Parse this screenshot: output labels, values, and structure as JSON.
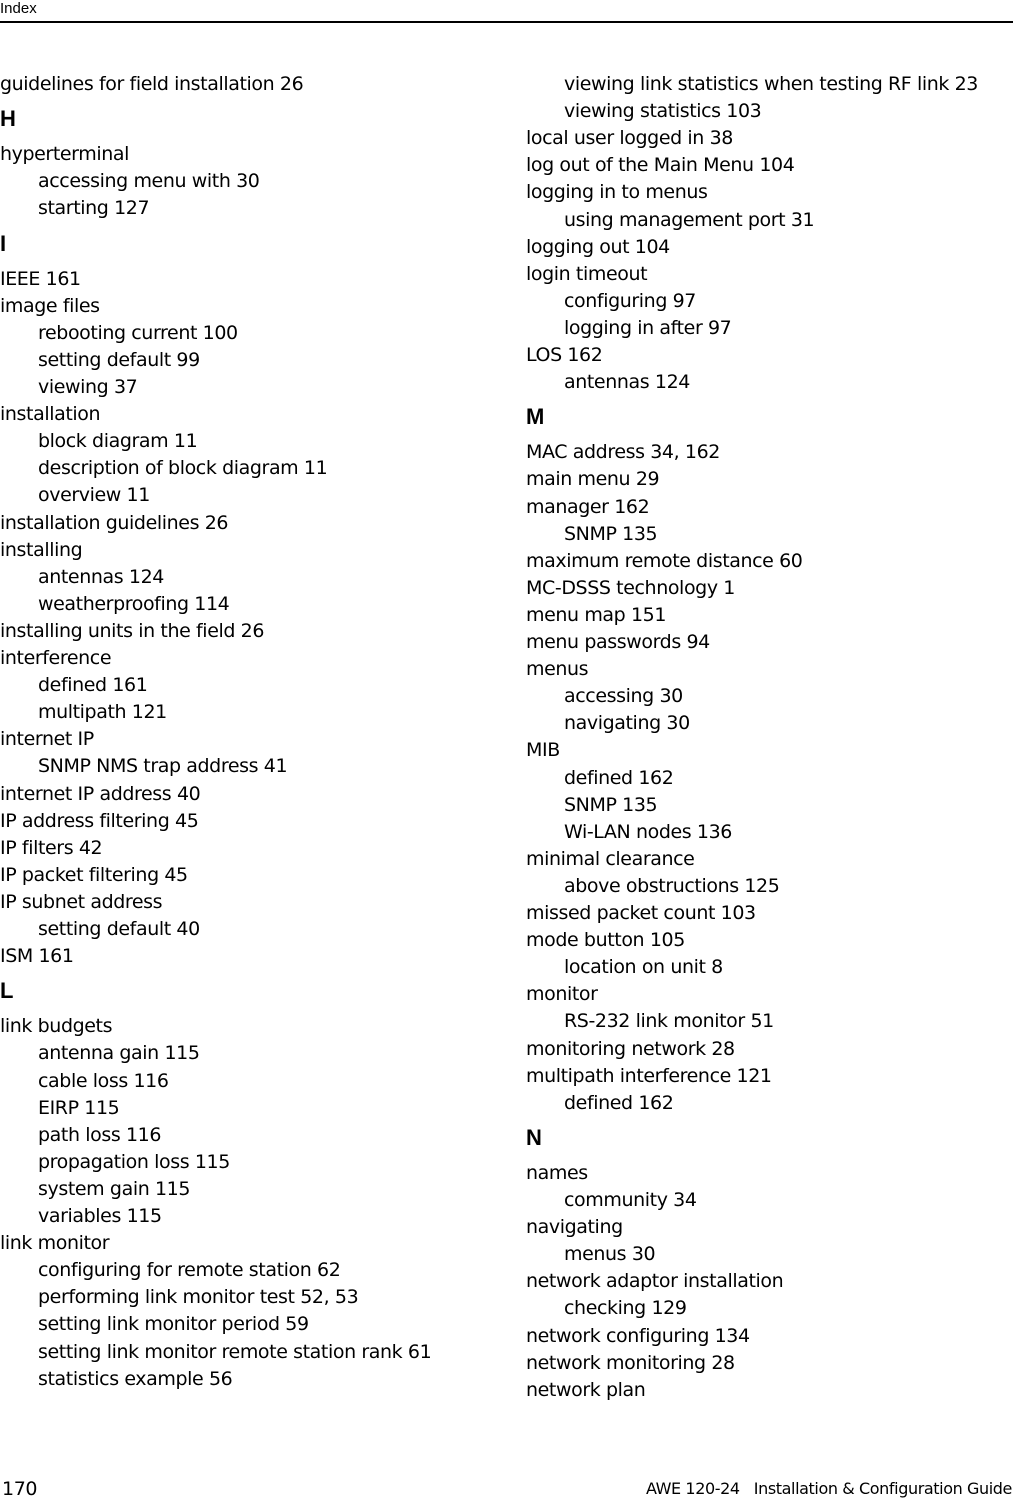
{
  "header": {
    "title": "Index"
  },
  "footer": {
    "page_number": "170",
    "guide_title": "AWE 120-24   Installation & Configuration Guide"
  },
  "columns": [
    {
      "entries": [
        {
          "type": "entry",
          "text": "guidelines for field installation 26"
        },
        {
          "type": "heading",
          "text": "H"
        },
        {
          "type": "entry",
          "text": "hyperterminal"
        },
        {
          "type": "sub",
          "text": "accessing menu with 30"
        },
        {
          "type": "sub",
          "text": "starting 127"
        },
        {
          "type": "heading",
          "text": "I"
        },
        {
          "type": "entry",
          "text": "IEEE 161"
        },
        {
          "type": "entry",
          "text": "image files"
        },
        {
          "type": "sub",
          "text": "rebooting current 100"
        },
        {
          "type": "sub",
          "text": "setting default 99"
        },
        {
          "type": "sub",
          "text": "viewing 37"
        },
        {
          "type": "entry",
          "text": "installation"
        },
        {
          "type": "sub",
          "text": "block diagram 11"
        },
        {
          "type": "sub",
          "text": "description of block diagram 11"
        },
        {
          "type": "sub",
          "text": "overview 11"
        },
        {
          "type": "entry",
          "text": "installation guidelines 26"
        },
        {
          "type": "entry",
          "text": "installing"
        },
        {
          "type": "sub",
          "text": "antennas 124"
        },
        {
          "type": "sub",
          "text": "weatherproofing 114"
        },
        {
          "type": "entry",
          "text": "installing units in the field 26"
        },
        {
          "type": "entry",
          "text": "interference"
        },
        {
          "type": "sub",
          "text": "defined 161"
        },
        {
          "type": "sub",
          "text": "multipath 121"
        },
        {
          "type": "entry",
          "text": "internet IP"
        },
        {
          "type": "sub",
          "text": "SNMP NMS trap address 41"
        },
        {
          "type": "entry",
          "text": "internet IP address 40"
        },
        {
          "type": "entry",
          "text": "IP address filtering 45"
        },
        {
          "type": "entry",
          "text": "IP filters 42"
        },
        {
          "type": "entry",
          "text": "IP packet filtering 45"
        },
        {
          "type": "entry",
          "text": "IP subnet address"
        },
        {
          "type": "sub",
          "text": "setting default 40"
        },
        {
          "type": "entry",
          "text": "ISM 161"
        },
        {
          "type": "heading",
          "text": "L"
        },
        {
          "type": "entry",
          "text": "link budgets"
        },
        {
          "type": "sub",
          "text": "antenna gain 115"
        },
        {
          "type": "sub",
          "text": "cable loss 116"
        },
        {
          "type": "sub",
          "text": "EIRP 115"
        },
        {
          "type": "sub",
          "text": "path loss 116"
        },
        {
          "type": "sub",
          "text": "propagation loss 115"
        },
        {
          "type": "sub",
          "text": "system gain 115"
        },
        {
          "type": "sub",
          "text": "variables 115"
        },
        {
          "type": "entry",
          "text": "link monitor"
        },
        {
          "type": "sub",
          "text": "configuring for remote station 62"
        },
        {
          "type": "sub",
          "text": "performing link monitor test 52, 53"
        },
        {
          "type": "sub",
          "text": "setting link monitor period 59"
        },
        {
          "type": "sub",
          "text": "setting link monitor remote station rank 61"
        },
        {
          "type": "sub",
          "text": "statistics example 56"
        }
      ]
    },
    {
      "entries": [
        {
          "type": "sub",
          "text": "viewing link statistics when testing RF link 23"
        },
        {
          "type": "sub",
          "text": "viewing statistics 103"
        },
        {
          "type": "entry",
          "text": "local user logged in 38"
        },
        {
          "type": "entry",
          "text": "log out of the Main Menu 104"
        },
        {
          "type": "entry",
          "text": "logging in to menus"
        },
        {
          "type": "sub",
          "text": "using management port 31"
        },
        {
          "type": "entry",
          "text": "logging out 104"
        },
        {
          "type": "entry",
          "text": "login timeout"
        },
        {
          "type": "sub",
          "text": "configuring 97"
        },
        {
          "type": "sub",
          "text": "logging in after 97"
        },
        {
          "type": "entry",
          "text": "LOS 162"
        },
        {
          "type": "sub",
          "text": "antennas 124"
        },
        {
          "type": "heading",
          "text": "M"
        },
        {
          "type": "entry",
          "text": "MAC address 34, 162"
        },
        {
          "type": "entry",
          "text": "main menu 29"
        },
        {
          "type": "entry",
          "text": "manager 162"
        },
        {
          "type": "sub",
          "text": "SNMP 135"
        },
        {
          "type": "entry",
          "text": "maximum remote distance 60"
        },
        {
          "type": "entry",
          "text": "MC-DSSS technology 1"
        },
        {
          "type": "entry",
          "text": "menu map 151"
        },
        {
          "type": "entry",
          "text": "menu passwords 94"
        },
        {
          "type": "entry",
          "text": "menus"
        },
        {
          "type": "sub",
          "text": "accessing 30"
        },
        {
          "type": "sub",
          "text": "navigating 30"
        },
        {
          "type": "entry",
          "text": "MIB"
        },
        {
          "type": "sub",
          "text": "defined 162"
        },
        {
          "type": "sub",
          "text": "SNMP 135"
        },
        {
          "type": "sub",
          "text": "Wi-LAN nodes 136"
        },
        {
          "type": "entry",
          "text": "minimal clearance"
        },
        {
          "type": "sub",
          "text": "above obstructions 125"
        },
        {
          "type": "entry",
          "text": "missed packet count 103"
        },
        {
          "type": "entry",
          "text": "mode button 105"
        },
        {
          "type": "sub",
          "text": "location on unit 8"
        },
        {
          "type": "entry",
          "text": "monitor"
        },
        {
          "type": "sub",
          "text": "RS-232 link monitor 51"
        },
        {
          "type": "entry",
          "text": "monitoring network 28"
        },
        {
          "type": "entry",
          "text": "multipath interference 121"
        },
        {
          "type": "sub",
          "text": "defined 162"
        },
        {
          "type": "heading",
          "text": "N"
        },
        {
          "type": "entry",
          "text": "names"
        },
        {
          "type": "sub",
          "text": "community 34"
        },
        {
          "type": "entry",
          "text": "navigating"
        },
        {
          "type": "sub",
          "text": "menus 30"
        },
        {
          "type": "entry",
          "text": "network adaptor installation"
        },
        {
          "type": "sub",
          "text": "checking 129"
        },
        {
          "type": "entry",
          "text": "network configuring 134"
        },
        {
          "type": "entry",
          "text": "network monitoring 28"
        },
        {
          "type": "entry",
          "text": "network plan"
        }
      ]
    }
  ]
}
